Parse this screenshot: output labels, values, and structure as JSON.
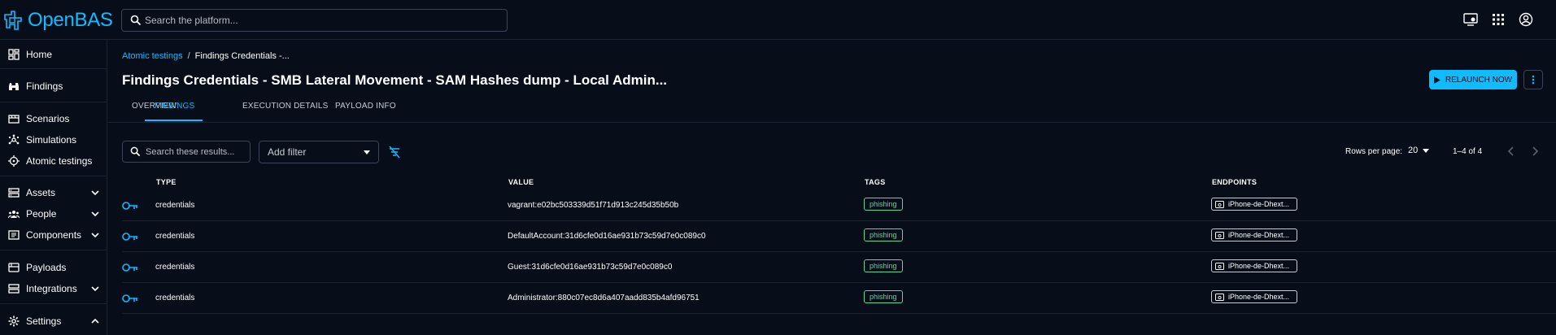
{
  "app": {
    "name": "OpenBAS",
    "brand_color": "#0fbcff"
  },
  "topbar": {
    "search_placeholder": "Search the platform...",
    "icons": [
      "screen-icon",
      "apps-grid-icon",
      "account-icon"
    ]
  },
  "sidebar": {
    "items": [
      {
        "label": "Home",
        "icon": "dashboard-icon"
      },
      {
        "label": "Findings",
        "icon": "binoculars-icon"
      },
      {
        "label": "Scenarios",
        "icon": "movie-icon"
      },
      {
        "label": "Simulations",
        "icon": "hub-icon"
      },
      {
        "label": "Atomic testings",
        "icon": "target-icon"
      },
      {
        "label": "Assets",
        "icon": "dns-icon",
        "expand": "down"
      },
      {
        "label": "People",
        "icon": "groups-icon",
        "expand": "down"
      },
      {
        "label": "Components",
        "icon": "components-icon",
        "expand": "down"
      },
      {
        "label": "Payloads",
        "icon": "payload-icon"
      },
      {
        "label": "Integrations",
        "icon": "integrations-icon",
        "expand": "down"
      },
      {
        "label": "Settings",
        "icon": "settings-icon",
        "expand": "up"
      }
    ]
  },
  "breadcrumb": {
    "parent": "Atomic testings",
    "separator": "/",
    "current": "Findings Credentials -..."
  },
  "page": {
    "title": "Findings Credentials - SMB Lateral Movement - SAM Hashes dump - Local Admin...",
    "relaunch_label": "RELAUNCH NOW"
  },
  "tabs": [
    {
      "label": "OVERVIEW",
      "active": false
    },
    {
      "label": "FINDINGS",
      "active": true
    },
    {
      "label": "EXECUTION DETAILS",
      "active": false
    },
    {
      "label": "PAYLOAD INFO",
      "active": false
    }
  ],
  "filters": {
    "search_placeholder": "Search these results...",
    "add_filter_label": "Add filter"
  },
  "pagination": {
    "rows_per_page_label": "Rows per page:",
    "rows_per_page": "20",
    "range": "1–4 of 4"
  },
  "table": {
    "columns": [
      "TYPE",
      "VALUE",
      "TAGS",
      "ENDPOINTS"
    ],
    "rows": [
      {
        "type": "credentials",
        "value": "vagrant:e02bc503339d51f71d913c245d35b50b",
        "tag": "phishing",
        "endpoint": "iPhone-de-Dhext..."
      },
      {
        "type": "credentials",
        "value": "DefaultAccount:31d6cfe0d16ae931b73c59d7e0c089c0",
        "tag": "phishing",
        "endpoint": "iPhone-de-Dhext..."
      },
      {
        "type": "credentials",
        "value": "Guest:31d6cfe0d16ae931b73c59d7e0c089c0",
        "tag": "phishing",
        "endpoint": "iPhone-de-Dhext..."
      },
      {
        "type": "credentials",
        "value": "Administrator:880c07ec8d6a407aadd835b4afd96751",
        "tag": "phishing",
        "endpoint": "iPhone-de-Dhext..."
      }
    ]
  },
  "colors": {
    "background": "#070d19",
    "accent": "#0fbcff",
    "tag": "#5fd69c",
    "divider": "#1c2434"
  }
}
